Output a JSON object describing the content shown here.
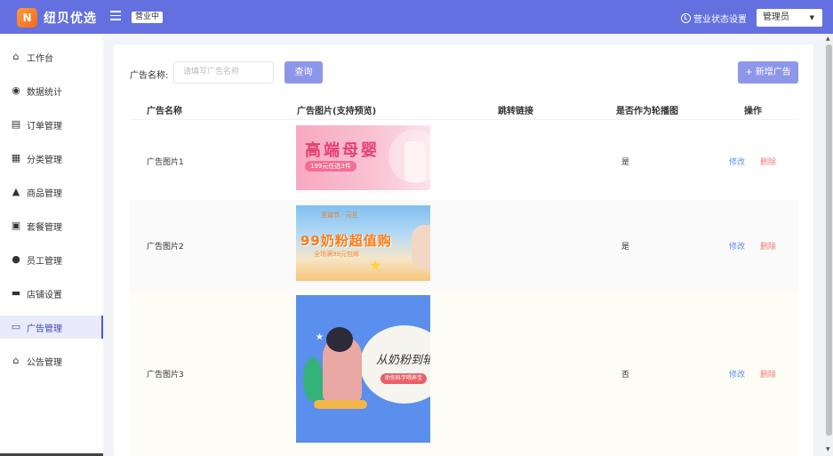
{
  "header": {
    "logo_mark": "N",
    "logo_text": "纽贝优选",
    "status_tag": "营业中",
    "biz_setting": "营业状态设置",
    "role": "管理员"
  },
  "sidebar": {
    "items": [
      {
        "label": "工作台",
        "icon": "home-icon"
      },
      {
        "label": "数据统计",
        "icon": "chart-icon"
      },
      {
        "label": "订单管理",
        "icon": "clipboard-icon"
      },
      {
        "label": "分类管理",
        "icon": "grid-icon"
      },
      {
        "label": "商品管理",
        "icon": "dish-icon"
      },
      {
        "label": "套餐管理",
        "icon": "gift-icon"
      },
      {
        "label": "员工管理",
        "icon": "info-icon"
      },
      {
        "label": "店铺设置",
        "icon": "shop-icon"
      },
      {
        "label": "广告管理",
        "icon": "monitor-icon"
      },
      {
        "label": "公告管理",
        "icon": "bank-icon"
      }
    ],
    "active_index": 8
  },
  "search": {
    "label": "广告名称:",
    "placeholder": "请填写广告名称",
    "query_label": "查询",
    "add_label": "+ 新增广告"
  },
  "table": {
    "headers": [
      "广告名称",
      "广告图片(支持预览)",
      "跳转链接",
      "是否作为轮播图",
      "操作"
    ],
    "rows": [
      {
        "name": "广告图片1",
        "link": "",
        "carousel": "是",
        "edit": "修改",
        "delete": "删除",
        "banner": {
          "title": "高端母婴",
          "sub": "199元任选3件"
        }
      },
      {
        "name": "广告图片2",
        "link": "",
        "carousel": "是",
        "edit": "修改",
        "delete": "删除",
        "banner": {
          "top": "圣诞节 · 元旦",
          "title": "99奶粉超值购",
          "sub": "全场满99元包邮"
        }
      },
      {
        "name": "广告图片3",
        "link": "",
        "carousel": "否",
        "edit": "修改",
        "delete": "删除",
        "banner": {
          "title": "从奶粉到辅",
          "tag": "助你科学喂养宝"
        }
      }
    ]
  },
  "colors": {
    "header": "#6470e0",
    "primary_button": "#8d97ea",
    "active_nav_bg": "#e9ebfb",
    "edit_link": "#5b8ff0",
    "delete_link": "#f07a7a"
  }
}
